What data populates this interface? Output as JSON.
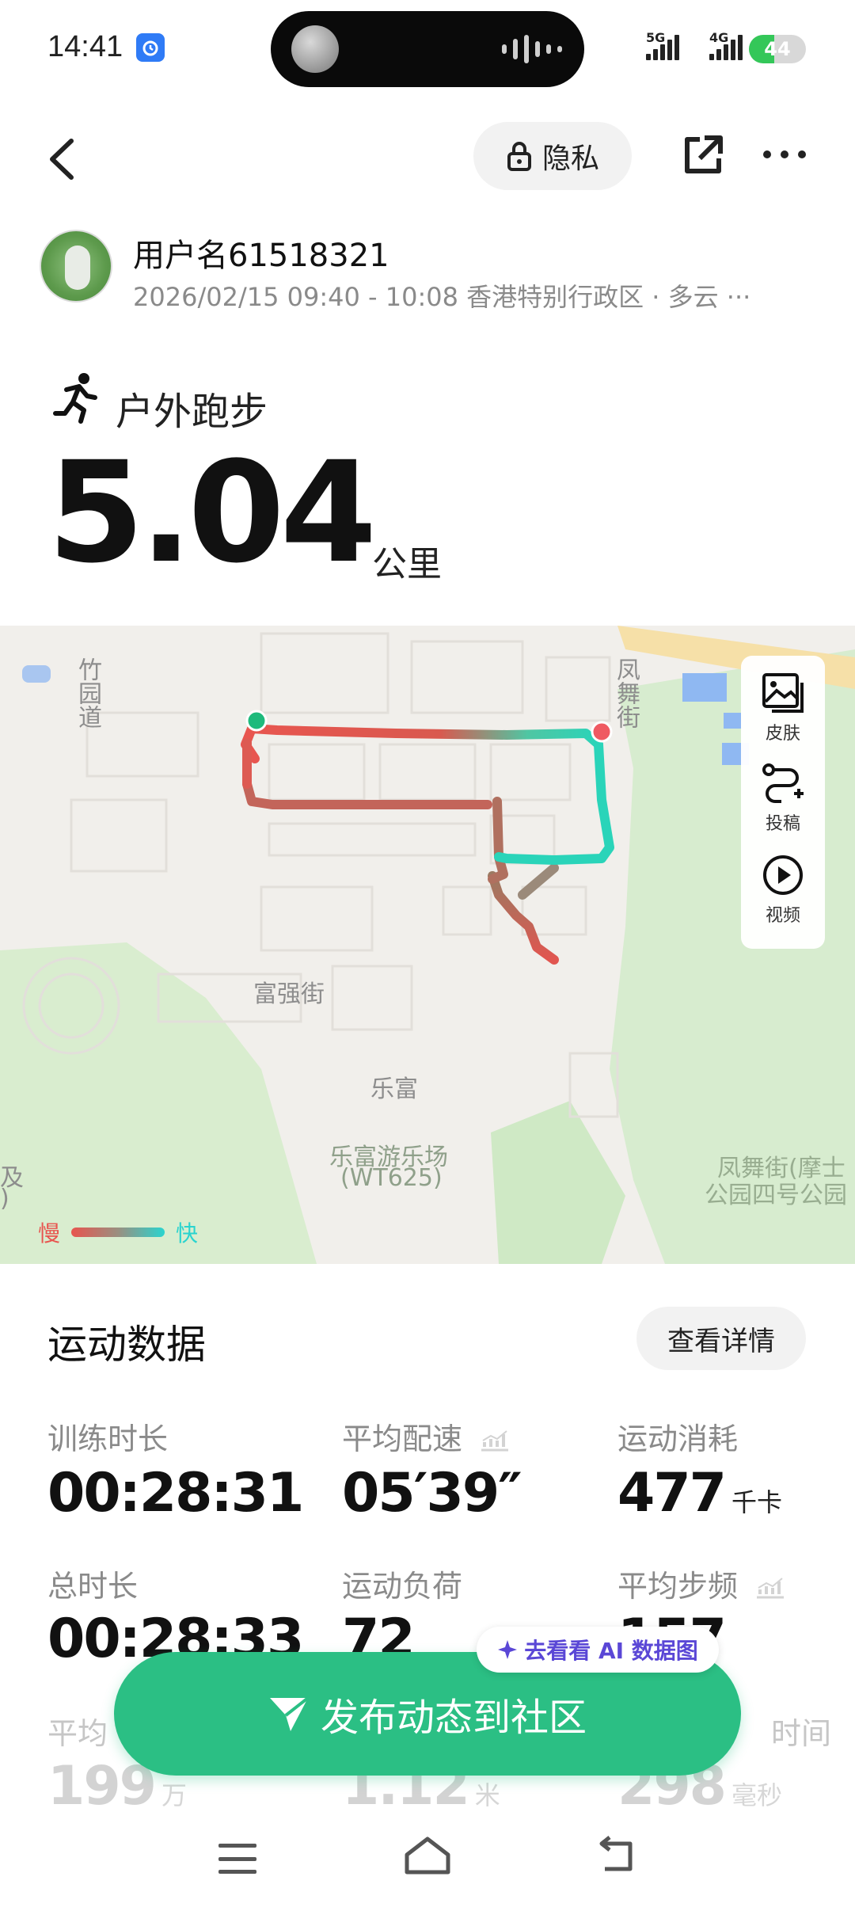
{
  "status_bar": {
    "time": "14:41",
    "net1": "5G",
    "net2": "4G",
    "battery": "44",
    "battery_level": 0.44
  },
  "header": {
    "privacy_label": "隐私"
  },
  "user": {
    "name": "用户名61518321",
    "meta": "2026/02/15 09:40 - 10:08 香港特别行政区 · 多云 ···"
  },
  "sport": {
    "type": "户外跑步",
    "distance": "5.04",
    "distance_unit": "公里"
  },
  "map": {
    "labels": {
      "zhuyuan": "竹园道",
      "fengwu": "凤舞街",
      "fuqiang": "富强街",
      "lefu": "乐富",
      "playground": "乐富游乐场",
      "playground_code": "(WT625)",
      "park1": "凤舞街(摩士",
      "park2": "公园四号公园",
      "edge1": "及",
      "edge2": ")"
    },
    "tools": {
      "skin": "皮肤",
      "submit": "投稿",
      "video": "视频"
    },
    "legend": {
      "slow": "慢",
      "fast": "快"
    },
    "colors": {
      "slow": "#e8554f",
      "fast": "#2ad4cf"
    }
  },
  "stats": {
    "title": "运动数据",
    "details_button": "查看详情",
    "training_time_label": "训练时长",
    "training_time": "00:28:31",
    "avg_pace_label": "平均配速",
    "avg_pace": "05′39″",
    "calories_label": "运动消耗",
    "calories": "477",
    "calories_unit": "千卡",
    "total_time_label": "总时长",
    "total_time": "00:28:33",
    "load_label": "运动负荷",
    "load": "72",
    "cadence_label": "平均步频",
    "cadence_partial": "157",
    "row3_label1": "平均",
    "row3_value1": "199",
    "row3_unit1": "万",
    "row3_value2": "1.12",
    "row3_unit2": "米",
    "row3_label3": "时间",
    "row3_value3": "298",
    "row3_unit3": "毫秒"
  },
  "ai_chip": {
    "label": "去看看 AI 数据图"
  },
  "publish": {
    "label": "发布动态到社区"
  }
}
